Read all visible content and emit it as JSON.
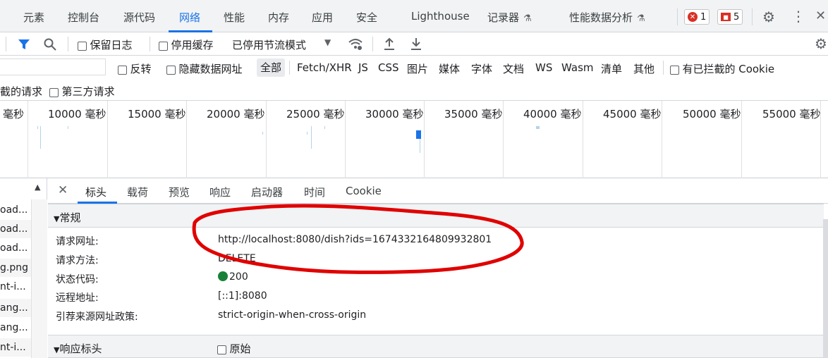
{
  "tabs": [
    "元素",
    "控制台",
    "源代码",
    "网络",
    "性能",
    "内存",
    "应用",
    "安全",
    "Lighthouse",
    "记录器",
    "性能数据分析"
  ],
  "active_tab": "网络",
  "badges": {
    "errors": "1",
    "issues": "5"
  },
  "toolbar": {
    "preserve_log": "保留日志",
    "disable_cache": "停用缓存",
    "throttling": "已停用节流模式"
  },
  "filters": {
    "invert": "反转",
    "hide_data_urls": "隐藏数据网址",
    "types": [
      "全部",
      "Fetch/XHR",
      "JS",
      "CSS",
      "图片",
      "媒体",
      "字体",
      "文档",
      "WS",
      "Wasm",
      "清单",
      "其他"
    ],
    "blocked_cookies": "有已拦截的 Cookie",
    "blocked_requests_partial": "截的请求",
    "third_party": "第三方请求"
  },
  "timeline_ticks": [
    "毫秒",
    "10000 毫秒",
    "15000 毫秒",
    "20000 毫秒",
    "25000 毫秒",
    "30000 毫秒",
    "35000 毫秒",
    "40000 毫秒",
    "45000 毫秒",
    "50000 毫秒",
    "55000 毫秒"
  ],
  "request_list": [
    "oad...",
    "oad...",
    "oad...",
    "g.png",
    "nt-i...",
    "ang...",
    "ang...",
    "nt-i..."
  ],
  "detail_tabs": [
    "标头",
    "载荷",
    "预览",
    "响应",
    "启动器",
    "时间",
    "Cookie"
  ],
  "active_detail_tab": "标头",
  "general": {
    "title": "常规",
    "rows": [
      {
        "key": "请求网址:",
        "value": "http://localhost:8080/dish?ids=1674332164809932801"
      },
      {
        "key": "请求方法:",
        "value": "DELETE"
      },
      {
        "key": "状态代码:",
        "value": "200"
      },
      {
        "key": "远程地址:",
        "value": "[::1]:8080"
      },
      {
        "key": "引荐来源网址政策:",
        "value": "strict-origin-when-cross-origin"
      }
    ]
  },
  "response_headers": {
    "title": "响应标头",
    "raw": "原始"
  },
  "colors": {
    "accent": "#1a73e8",
    "annotation": "#e00000",
    "status_ok": "#188038"
  }
}
